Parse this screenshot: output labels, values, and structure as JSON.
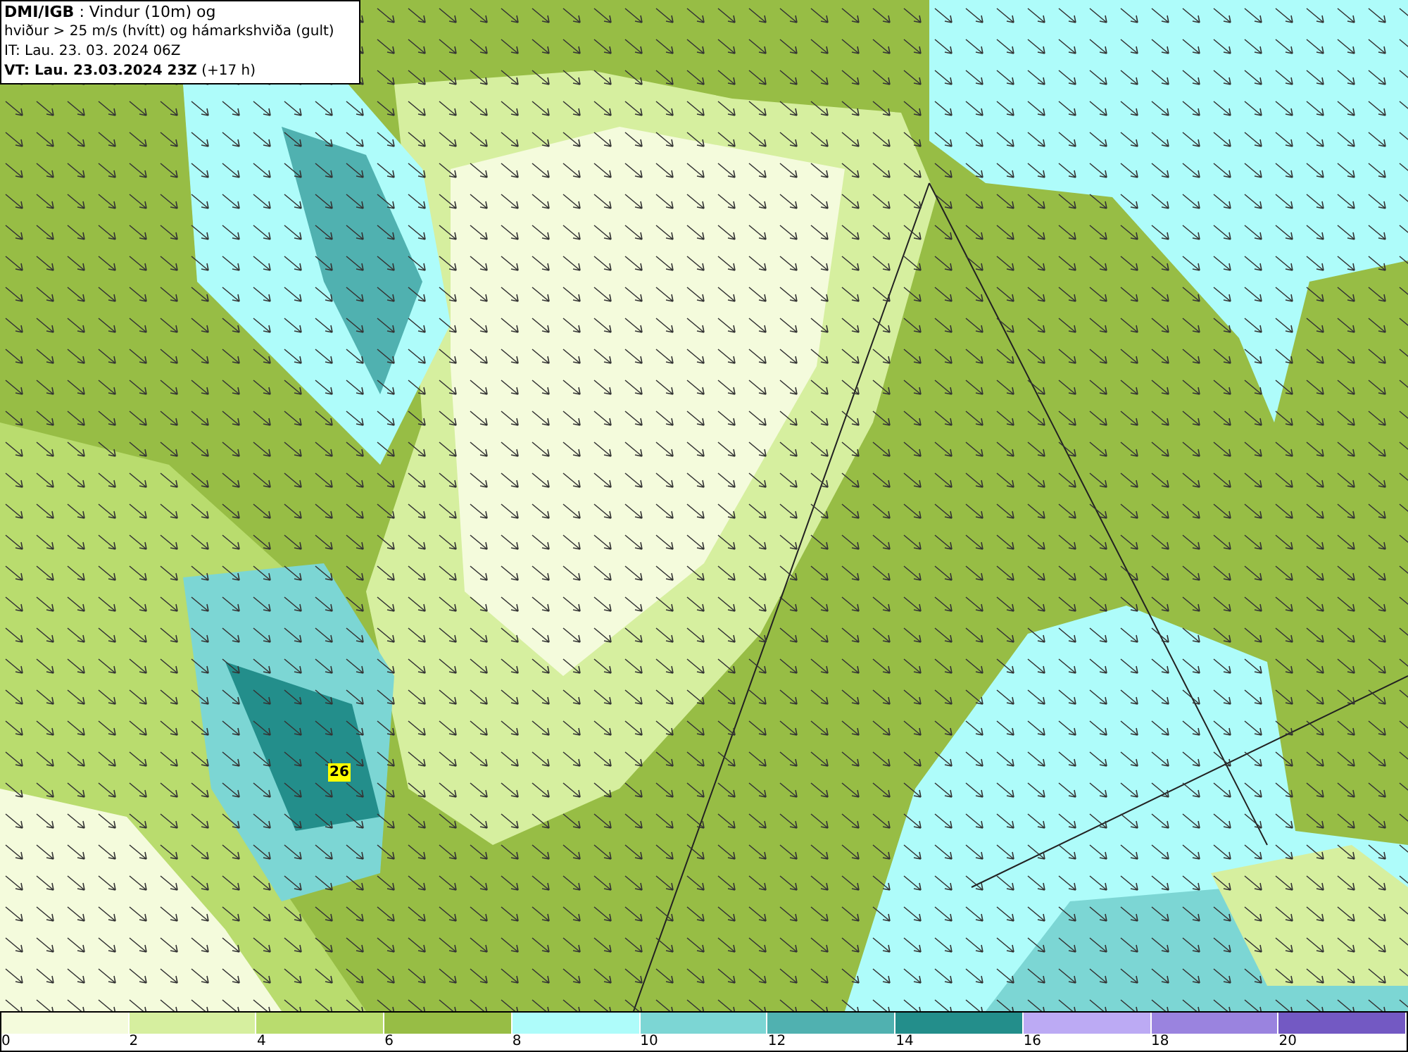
{
  "info_box": {
    "lines": [
      "**DMI/IGB** : Vindur (10m) og",
      "hviður > 25 m/s (hvítt) og hámarkshviða (gult)",
      "IT: Lau. 23. 03. 2024 06Z",
      "**VT: Lau. 23.03.2024 23Z** (+17 h)"
    ]
  },
  "map": {
    "gust_marker": {
      "value": "26",
      "color": "#ffff00"
    }
  },
  "legend": {
    "bins": [
      {
        "color": "#f4fbdc",
        "label": "0"
      },
      {
        "color": "#d6ef9f",
        "label": "2"
      },
      {
        "color": "#b9dc6e",
        "label": "4"
      },
      {
        "color": "#97bd45",
        "label": "6"
      },
      {
        "color": "#aefcfa",
        "label": "8"
      },
      {
        "color": "#7cd6d4",
        "label": "10"
      },
      {
        "color": "#50b1b0",
        "label": "12"
      },
      {
        "color": "#238e8b",
        "label": "14"
      },
      {
        "color": "#bcaaf4",
        "label": "16"
      },
      {
        "color": "#9a83df",
        "label": "18"
      },
      {
        "color": "#7359c3",
        "label": "20"
      }
    ]
  }
}
